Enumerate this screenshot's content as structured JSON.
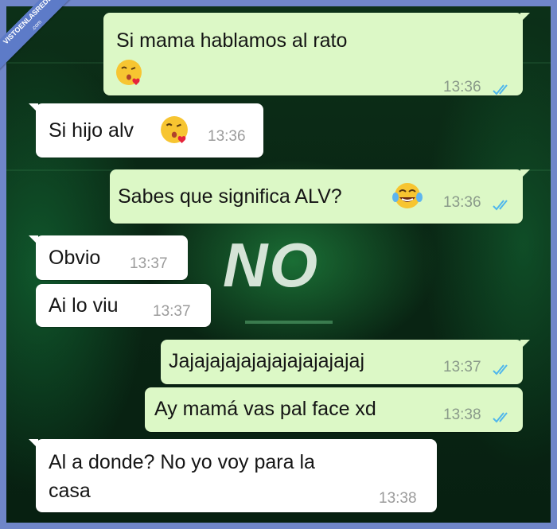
{
  "watermark": {
    "line1": "VISTOENLASREDES",
    "line2": ".com"
  },
  "background_text": "NO",
  "colors": {
    "outgoing_bubble": "#dcf8c6",
    "incoming_bubble": "#ffffff",
    "read_ticks": "#4fb6ec",
    "border": "#6f86c9"
  },
  "messages": [
    {
      "direction": "outgoing",
      "text": "Si mama hablamos al rato",
      "emoji": "face-blowing-kiss",
      "time": "13:36",
      "status": "read"
    },
    {
      "direction": "incoming",
      "text": "Si hijo alv",
      "emoji": "face-blowing-kiss",
      "time": "13:36"
    },
    {
      "direction": "outgoing",
      "text": "Sabes que significa ALV?",
      "emoji": "face-with-tears-of-joy",
      "time": "13:36",
      "status": "read"
    },
    {
      "direction": "incoming",
      "text": "Obvio",
      "time": "13:37"
    },
    {
      "direction": "incoming",
      "text": "Ai lo viu",
      "time": "13:37"
    },
    {
      "direction": "outgoing",
      "text": "Jajajajajajajajajajajajaj",
      "time": "13:37",
      "status": "read"
    },
    {
      "direction": "outgoing",
      "text": "Ay mamá vas pal face xd",
      "time": "13:38",
      "status": "read"
    },
    {
      "direction": "incoming",
      "text_line1": "Al a donde? No yo voy para la",
      "text_line2": "casa",
      "time": "13:38"
    }
  ]
}
